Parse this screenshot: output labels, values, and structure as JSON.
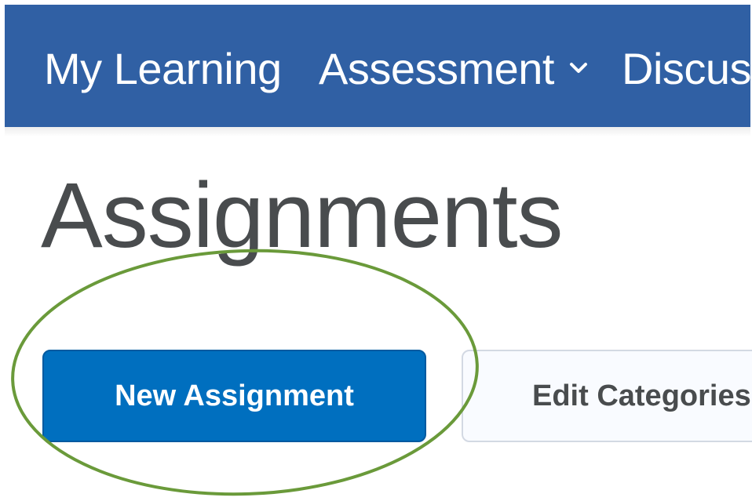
{
  "navbar": {
    "items": [
      {
        "label": "My Learning"
      },
      {
        "label": "Assessment",
        "icon": "chevron-down-icon"
      },
      {
        "label": "Discus"
      }
    ],
    "background_color": "#3060a4"
  },
  "page": {
    "title": "Assignments"
  },
  "actions": {
    "new_assignment_label": "New Assignment",
    "edit_categories_label": "Edit Categories",
    "primary_color": "#006fbf"
  },
  "annotation": {
    "highlight_color": "#6a9a3a"
  }
}
